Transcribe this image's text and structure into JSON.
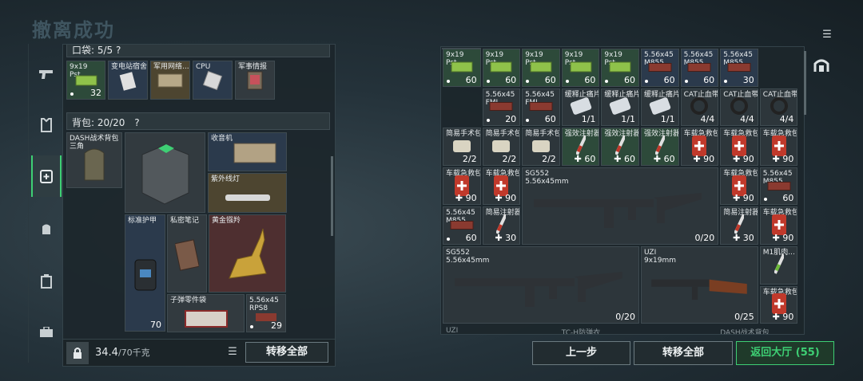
{
  "bg_title": "撤离成功",
  "sidebar": {
    "items": [
      "pistol-icon",
      "armor-icon",
      "medkit-icon",
      "backpack-icon",
      "case-icon",
      "toolbox-icon"
    ],
    "accent": "#3ecf74"
  },
  "left": {
    "pocket_header": "口袋: 5/5 ?",
    "pocket_items": [
      {
        "name": "9x19\nPst",
        "count": "32",
        "dot": true
      },
      {
        "name": "变电站宿舍",
        "count": ""
      },
      {
        "name": "军用网络...",
        "count": ""
      },
      {
        "name": "CPU",
        "count": ""
      },
      {
        "name": "军事情报",
        "count": ""
      }
    ],
    "backpack_header": "背包: 20/20",
    "backpack_help": "?",
    "backpack_items": {
      "dash": "DASH战术背包\n三角",
      "radio": "收音机",
      "uvlamp": "紫外线灯",
      "armor": "标准护甲",
      "armor_count": "70",
      "notes": "私密笔记",
      "antelope": "黄金镪羚",
      "ammo_bag": "子弹零件袋",
      "ammo": "5.56x45\nRPS8",
      "ammo_count": "29"
    },
    "weight": "34.4",
    "weight_unit": "/70千克",
    "transfer_all": "转移全部"
  },
  "right": {
    "grid": [
      [
        {
          "n": "9x19\nPst",
          "c": "60",
          "bg": "green"
        },
        {
          "n": "9x19\nPst",
          "c": "60",
          "bg": "green"
        },
        {
          "n": "9x19\nPst",
          "c": "60",
          "bg": "green"
        },
        {
          "n": "9x19\nPst",
          "c": "60",
          "bg": "green"
        },
        {
          "n": "9x19\nPst",
          "c": "60",
          "bg": "green"
        },
        {
          "n": "5.56x45\nM855",
          "c": "60",
          "bg": "blue"
        },
        {
          "n": "5.56x45\nM855",
          "c": "60",
          "bg": "blue"
        },
        {
          "n": "5.56x45\nM855",
          "c": "30",
          "bg": "blue"
        }
      ],
      [
        {
          "n": "",
          "c": "",
          "bg": "gray"
        },
        {
          "n": "5.56x45\nFMJ",
          "c": "20",
          "bg": "gray"
        },
        {
          "n": "5.56x45\nFMJ",
          "c": "60",
          "bg": "gray"
        },
        {
          "n": "缓释止痛片",
          "c": "1/1",
          "bg": "gray"
        },
        {
          "n": "缓释止痛片",
          "c": "1/1",
          "bg": "gray"
        },
        {
          "n": "缓释止痛片",
          "c": "1/1",
          "bg": "gray"
        },
        {
          "n": "CAT止血带",
          "c": "4/4",
          "bg": "gray"
        },
        {
          "n": "CAT止血带",
          "c": "4/4",
          "bg": "gray"
        },
        {
          "n": "CAT止血带",
          "c": "4/4",
          "bg": "gray"
        }
      ],
      [
        {
          "n": "简易手术包",
          "c": "2/2",
          "bg": "gray"
        },
        {
          "n": "简易手术包",
          "c": "2/2",
          "bg": "gray"
        },
        {
          "n": "简易手术包",
          "c": "2/2",
          "bg": "gray"
        },
        {
          "n": "强效注射器",
          "c": "60",
          "bg": "green"
        },
        {
          "n": "强效注射器",
          "c": "60",
          "bg": "green"
        },
        {
          "n": "强效注射器",
          "c": "60",
          "bg": "green"
        },
        {
          "n": "车载急救包",
          "c": "90",
          "bg": "gray"
        },
        {
          "n": "车载急救包",
          "c": "90",
          "bg": "gray"
        },
        {
          "n": "车载急救包",
          "c": "90",
          "bg": "gray"
        }
      ]
    ],
    "row4_left": [
      {
        "n": "车载急救包",
        "c": "90"
      },
      {
        "n": "车载急救包",
        "c": "90"
      }
    ],
    "sg552_a": {
      "name": "SG552\n5.56x45mm",
      "c": "0/20"
    },
    "row4_right": [
      {
        "n": "车载急救包",
        "c": "90"
      },
      {
        "n": "5.56x45\nM855",
        "c": "60"
      }
    ],
    "row5_left": [
      {
        "n": "5.56x45\nM855",
        "c": "60"
      },
      {
        "n": "简易注射器",
        "c": "30"
      }
    ],
    "row5_right": [
      {
        "n": "简易注射器",
        "c": "30"
      },
      {
        "n": "车载急救包",
        "c": "90"
      }
    ],
    "sg552_b": {
      "name": "SG552\n5.56x45mm",
      "c": "0/20"
    },
    "uzi": {
      "name": "UZI\n9x19mm",
      "c": "0/25"
    },
    "m1": {
      "n": "M1肌肉...",
      "c": ""
    },
    "last_kit": {
      "n": "车载急救包",
      "c": "90"
    },
    "bottom_labels": [
      "UZI",
      "TC-H防弹衣",
      "DASH战术背包"
    ]
  },
  "buttons": {
    "back": "上一步",
    "transfer_all": "转移全部",
    "lobby": "返回大厅 (55)"
  }
}
